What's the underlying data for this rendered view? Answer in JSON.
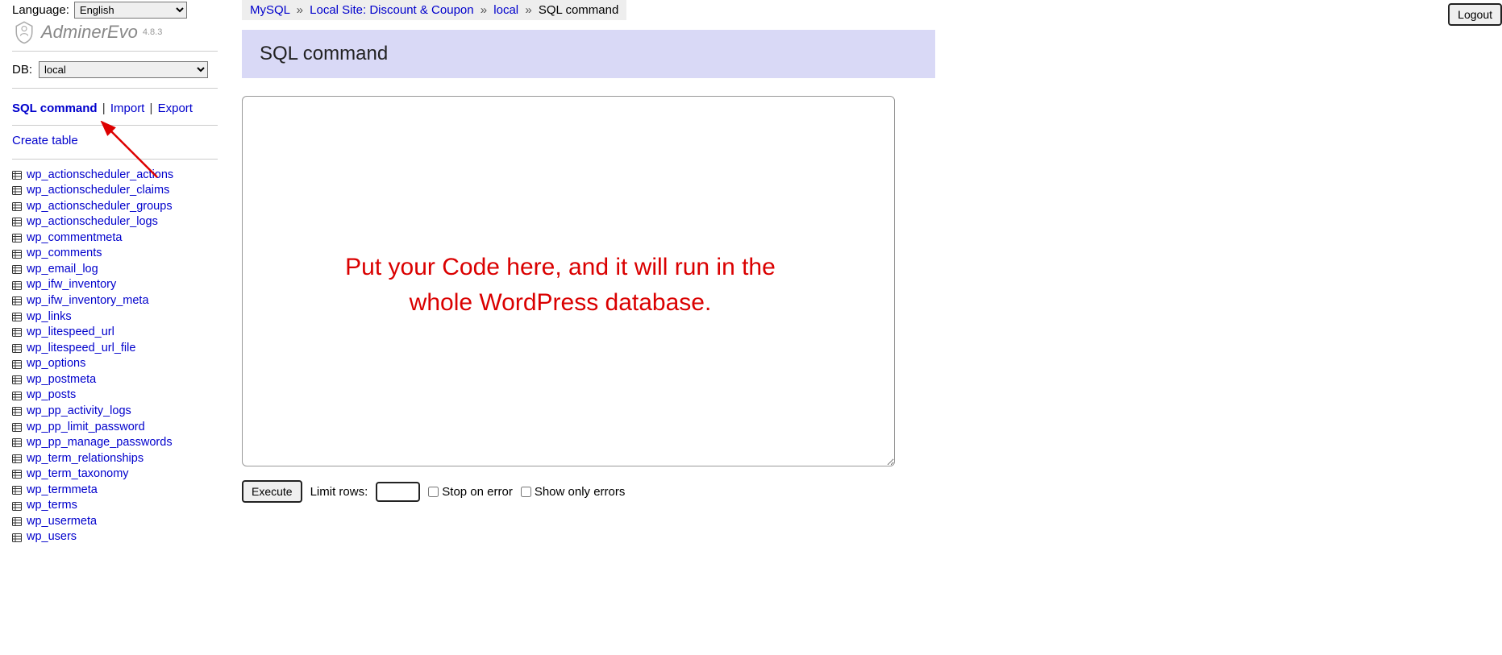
{
  "language": {
    "label": "Language:",
    "value": "English"
  },
  "brand": {
    "name": "AdminerEvo",
    "version": "4.8.3"
  },
  "db": {
    "label": "DB:",
    "value": "local"
  },
  "links": {
    "sql_command": "SQL command",
    "import": "Import",
    "export": "Export",
    "create_table": "Create table"
  },
  "tables": [
    "wp_actionscheduler_actions",
    "wp_actionscheduler_claims",
    "wp_actionscheduler_groups",
    "wp_actionscheduler_logs",
    "wp_commentmeta",
    "wp_comments",
    "wp_email_log",
    "wp_ifw_inventory",
    "wp_ifw_inventory_meta",
    "wp_links",
    "wp_litespeed_url",
    "wp_litespeed_url_file",
    "wp_options",
    "wp_postmeta",
    "wp_posts",
    "wp_pp_activity_logs",
    "wp_pp_limit_password",
    "wp_pp_manage_passwords",
    "wp_term_relationships",
    "wp_term_taxonomy",
    "wp_termmeta",
    "wp_terms",
    "wp_usermeta",
    "wp_users"
  ],
  "breadcrumb": {
    "driver": "MySQL",
    "server": "Local Site: Discount & Coupon",
    "db": "local",
    "page": "SQL command"
  },
  "heading": "SQL command",
  "overlay_note": "Put your Code here, and it will run in the whole WordPress database.",
  "form": {
    "execute": "Execute",
    "limit_label": "Limit rows:",
    "limit_value": "",
    "stop_on_error": "Stop on error",
    "show_only_errors": "Show only errors"
  },
  "logout": "Logout"
}
